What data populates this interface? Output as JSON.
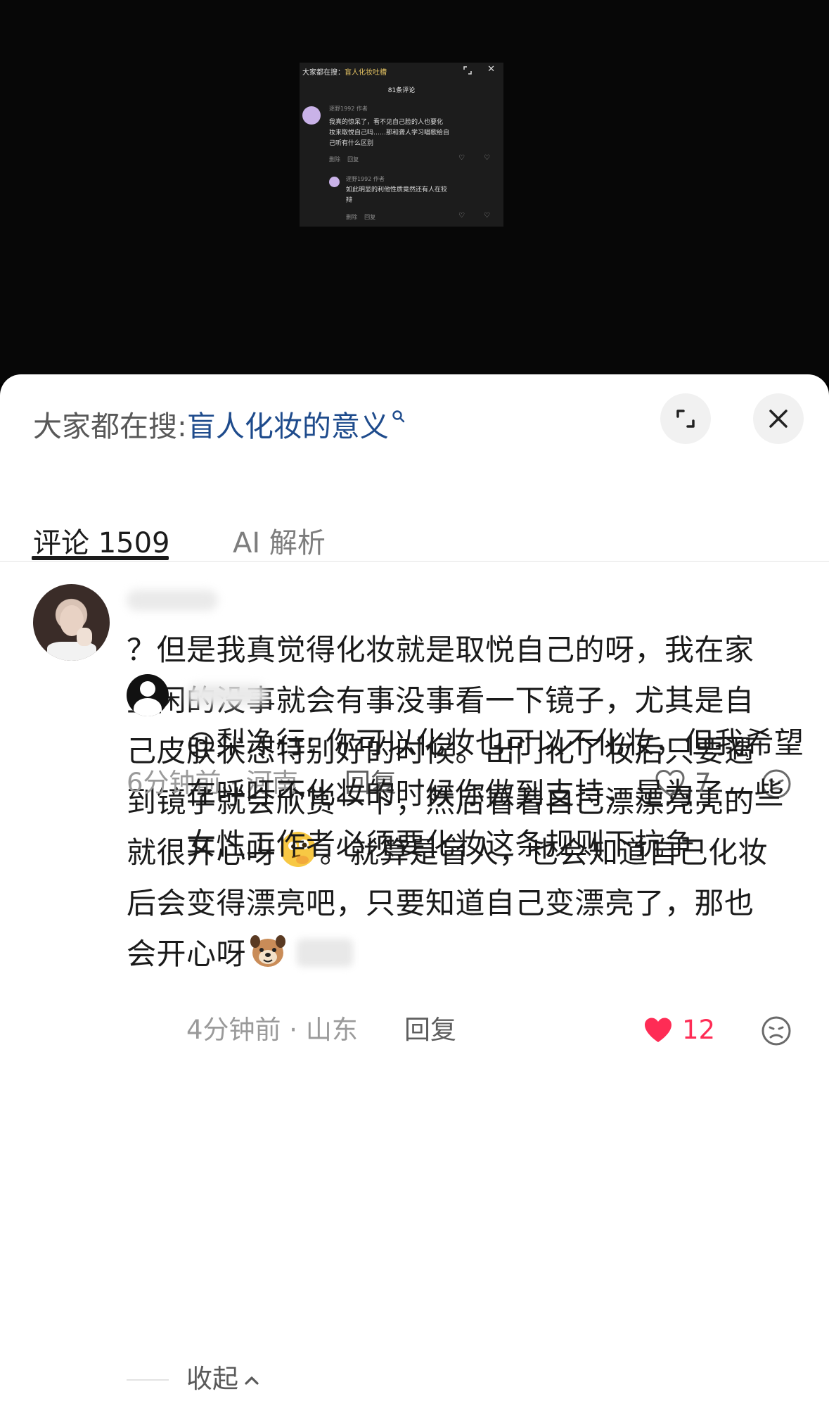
{
  "video": {
    "thumbnail": {
      "search_prefix": "大家都在搜：",
      "search_keyword": "盲人化妆吐槽",
      "comment_count": "81条评论",
      "comment1": {
        "user": "逐野1992",
        "badge": "作者",
        "text_lines": [
          "我真的惊呆了，看不见自己脸的人也要化",
          "妆来取悦自己吗……那和聋人学习唱歌给自",
          "己听有什么区别"
        ],
        "meta": "删除",
        "reply": "回复"
      },
      "comment2": {
        "user": "逐野1992",
        "badge": "作者",
        "text_lines": [
          "如此明显的利他性质竟然还有人在狡",
          "辩"
        ],
        "meta": "删除",
        "reply": "回复"
      }
    }
  },
  "sheet": {
    "search_prefix": "大家都在搜:",
    "search_keyword": "盲人化妆的意义",
    "icons": {
      "search": "search-icon",
      "expand": "expand-icon",
      "close": "close-icon"
    }
  },
  "tabs": [
    {
      "label": "评论 1509",
      "active": true
    },
    {
      "label": "AI 解析",
      "active": false
    }
  ],
  "comments": [
    {
      "text": "？但是我真觉得化妆就是取悦自己的呀，我在家里闲的没事就会有事没事看一下镜子，尤其是自己皮肤状态特别好的时候。出门化了妆后只要遇到镜子就会欣赏一下，然后看着自己漂漂亮亮的就很开心呀",
      "text_after_emoji1": "。就算是盲人，也会知道自己化妆后会变得漂亮吧，只要知道自己变漂亮了，那也会开心呀",
      "emoji1": "thinking-face-emoji",
      "emoji2": "puppy-emoji",
      "meta": "6分钟前 · 河南",
      "reply_label": "回复",
      "likes": "7",
      "liked": false,
      "replies": [
        {
          "text": "@梨净行: 你可以化妆也可以不化妆，但我希望在呼吁不化妆的时候你做到支持，是为了一些女性工作者必须要化妆这条规则下抗争",
          "meta": "4分钟前 · 山东",
          "reply_label": "回复",
          "likes": "12",
          "liked": true,
          "like_color": "#fe2c55"
        }
      ]
    }
  ],
  "collapse_label": "收起"
}
